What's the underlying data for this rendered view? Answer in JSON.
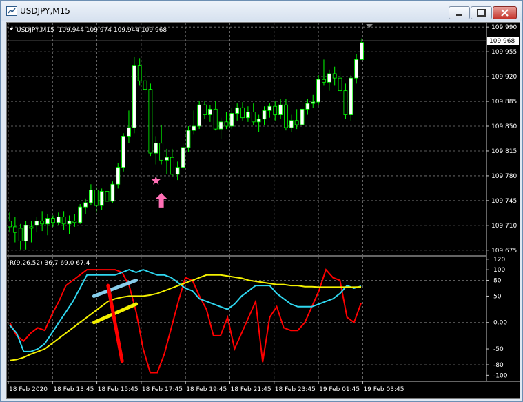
{
  "window": {
    "title": "USDJPY,M15"
  },
  "colors": {
    "background": "#000000",
    "grid": "#7c7c7c",
    "bull": "#ffffff",
    "bear": "#00ff00",
    "text": "#ffffff",
    "red_line": "#ff0000",
    "cyan_line": "#2fd7f0",
    "yellow_line": "#f3f000",
    "marker": "#ff6fb5"
  },
  "chart_data": [
    {
      "type": "candlestick",
      "header": {
        "symbol": "USDJPY,M15",
        "ohlc": "109.944 109.974 109.944 109.968"
      },
      "current_price": "109.968",
      "y_ticks": [
        "109.990",
        "109.955",
        "109.920",
        "109.885",
        "109.850",
        "109.815",
        "109.780",
        "109.745",
        "109.710",
        "109.675"
      ],
      "ylim": [
        109.668,
        109.996
      ],
      "candles": [
        {
          "o": 109.716,
          "h": 109.728,
          "l": 109.7,
          "c": 109.708
        },
        {
          "o": 109.708,
          "h": 109.722,
          "l": 109.686,
          "c": 109.7
        },
        {
          "o": 109.706,
          "h": 109.712,
          "l": 109.676,
          "c": 109.688
        },
        {
          "o": 109.688,
          "h": 109.716,
          "l": 109.676,
          "c": 109.71
        },
        {
          "o": 109.708,
          "h": 109.716,
          "l": 109.686,
          "c": 109.706
        },
        {
          "o": 109.71,
          "h": 109.722,
          "l": 109.7,
          "c": 109.716
        },
        {
          "o": 109.716,
          "h": 109.73,
          "l": 109.702,
          "c": 109.712
        },
        {
          "o": 109.712,
          "h": 109.726,
          "l": 109.696,
          "c": 109.72
        },
        {
          "o": 109.72,
          "h": 109.724,
          "l": 109.708,
          "c": 109.714
        },
        {
          "o": 109.714,
          "h": 109.728,
          "l": 109.71,
          "c": 109.722
        },
        {
          "o": 109.722,
          "h": 109.73,
          "l": 109.704,
          "c": 109.712
        },
        {
          "o": 109.712,
          "h": 109.724,
          "l": 109.698,
          "c": 109.716
        },
        {
          "o": 109.716,
          "h": 109.726,
          "l": 109.708,
          "c": 109.714
        },
        {
          "o": 109.714,
          "h": 109.74,
          "l": 109.712,
          "c": 109.736
        },
        {
          "o": 109.736,
          "h": 109.748,
          "l": 109.726,
          "c": 109.742
        },
        {
          "o": 109.742,
          "h": 109.768,
          "l": 109.738,
          "c": 109.76
        },
        {
          "o": 109.76,
          "h": 109.764,
          "l": 109.728,
          "c": 109.738
        },
        {
          "o": 109.738,
          "h": 109.762,
          "l": 109.732,
          "c": 109.758
        },
        {
          "o": 109.758,
          "h": 109.78,
          "l": 109.74,
          "c": 109.744
        },
        {
          "o": 109.744,
          "h": 109.772,
          "l": 109.742,
          "c": 109.768
        },
        {
          "o": 109.768,
          "h": 109.798,
          "l": 109.762,
          "c": 109.792
        },
        {
          "o": 109.792,
          "h": 109.84,
          "l": 109.786,
          "c": 109.836
        },
        {
          "o": 109.836,
          "h": 109.872,
          "l": 109.826,
          "c": 109.848
        },
        {
          "o": 109.848,
          "h": 109.948,
          "l": 109.84,
          "c": 109.936
        },
        {
          "o": 109.936,
          "h": 109.946,
          "l": 109.908,
          "c": 109.914
        },
        {
          "o": 109.914,
          "h": 109.928,
          "l": 109.896,
          "c": 109.902
        },
        {
          "o": 109.902,
          "h": 109.91,
          "l": 109.808,
          "c": 109.812
        },
        {
          "o": 109.812,
          "h": 109.836,
          "l": 109.796,
          "c": 109.826
        },
        {
          "o": 109.826,
          "h": 109.852,
          "l": 109.796,
          "c": 109.802
        },
        {
          "o": 109.802,
          "h": 109.818,
          "l": 109.782,
          "c": 109.806
        },
        {
          "o": 109.806,
          "h": 109.818,
          "l": 109.778,
          "c": 109.782
        },
        {
          "o": 109.782,
          "h": 109.8,
          "l": 109.774,
          "c": 109.792
        },
        {
          "o": 109.792,
          "h": 109.826,
          "l": 109.788,
          "c": 109.82
        },
        {
          "o": 109.82,
          "h": 109.85,
          "l": 109.814,
          "c": 109.844
        },
        {
          "o": 109.844,
          "h": 109.872,
          "l": 109.838,
          "c": 109.85
        },
        {
          "o": 109.85,
          "h": 109.886,
          "l": 109.846,
          "c": 109.88
        },
        {
          "o": 109.88,
          "h": 109.886,
          "l": 109.86,
          "c": 109.866
        },
        {
          "o": 109.866,
          "h": 109.88,
          "l": 109.856,
          "c": 109.874
        },
        {
          "o": 109.874,
          "h": 109.886,
          "l": 109.844,
          "c": 109.846
        },
        {
          "o": 109.846,
          "h": 109.862,
          "l": 109.832,
          "c": 109.856
        },
        {
          "o": 109.856,
          "h": 109.87,
          "l": 109.846,
          "c": 109.85
        },
        {
          "o": 109.85,
          "h": 109.876,
          "l": 109.846,
          "c": 109.868
        },
        {
          "o": 109.868,
          "h": 109.882,
          "l": 109.858,
          "c": 109.876
        },
        {
          "o": 109.876,
          "h": 109.884,
          "l": 109.858,
          "c": 109.862
        },
        {
          "o": 109.862,
          "h": 109.878,
          "l": 109.856,
          "c": 109.87
        },
        {
          "o": 109.87,
          "h": 109.882,
          "l": 109.852,
          "c": 109.856
        },
        {
          "o": 109.856,
          "h": 109.866,
          "l": 109.842,
          "c": 109.86
        },
        {
          "o": 109.86,
          "h": 109.878,
          "l": 109.852,
          "c": 109.872
        },
        {
          "o": 109.872,
          "h": 109.882,
          "l": 109.862,
          "c": 109.878
        },
        {
          "o": 109.878,
          "h": 109.886,
          "l": 109.858,
          "c": 109.866
        },
        {
          "o": 109.866,
          "h": 109.888,
          "l": 109.86,
          "c": 109.88
        },
        {
          "o": 109.88,
          "h": 109.888,
          "l": 109.844,
          "c": 109.848
        },
        {
          "o": 109.848,
          "h": 109.866,
          "l": 109.842,
          "c": 109.858
        },
        {
          "o": 109.858,
          "h": 109.874,
          "l": 109.846,
          "c": 109.852
        },
        {
          "o": 109.852,
          "h": 109.882,
          "l": 109.848,
          "c": 109.874
        },
        {
          "o": 109.874,
          "h": 109.888,
          "l": 109.866,
          "c": 109.882
        },
        {
          "o": 109.882,
          "h": 109.894,
          "l": 109.876,
          "c": 109.884
        },
        {
          "o": 109.884,
          "h": 109.922,
          "l": 109.88,
          "c": 109.916
        },
        {
          "o": 109.916,
          "h": 109.944,
          "l": 109.908,
          "c": 109.912
        },
        {
          "o": 109.912,
          "h": 109.93,
          "l": 109.9,
          "c": 109.924
        },
        {
          "o": 109.924,
          "h": 109.934,
          "l": 109.908,
          "c": 109.918
        },
        {
          "o": 109.918,
          "h": 109.928,
          "l": 109.896,
          "c": 109.9
        },
        {
          "o": 109.9,
          "h": 109.91,
          "l": 109.86,
          "c": 109.866
        },
        {
          "o": 109.866,
          "h": 109.922,
          "l": 109.858,
          "c": 109.918
        },
        {
          "o": 109.918,
          "h": 109.952,
          "l": 109.91,
          "c": 109.944
        },
        {
          "o": 109.944,
          "h": 109.974,
          "l": 109.944,
          "c": 109.968
        }
      ],
      "markers": [
        {
          "type": "star",
          "index": 27,
          "price": 109.773
        },
        {
          "type": "up-arrow",
          "index": 28,
          "price": 109.745
        }
      ]
    },
    {
      "type": "line",
      "header": "R(9,26,52) 36.7 69.0 67.4",
      "y_ticks": [
        "120",
        "100",
        "80",
        "50",
        "0.00",
        "-50",
        "-80",
        "-100"
      ],
      "ylim": [
        -110,
        125
      ],
      "series": [
        {
          "color": "#ff0000",
          "values": [
            0,
            -25,
            -35,
            -20,
            -10,
            -15,
            15,
            40,
            70,
            80,
            90,
            100,
            100,
            100,
            100,
            100,
            95,
            70,
            20,
            -50,
            -95,
            -95,
            -60,
            -10,
            40,
            85,
            80,
            50,
            25,
            -25,
            -25,
            10,
            -50,
            -20,
            10,
            40,
            -75,
            10,
            30,
            -10,
            -15,
            -15,
            0,
            30,
            60,
            100,
            85,
            80,
            10,
            0,
            36.7
          ]
        },
        {
          "color": "#2fd7f0",
          "values": [
            -5,
            -20,
            -55,
            -55,
            -50,
            -40,
            -20,
            0,
            20,
            40,
            65,
            90,
            90,
            90,
            90,
            90,
            95,
            100,
            95,
            100,
            95,
            90,
            90,
            85,
            75,
            65,
            60,
            45,
            40,
            35,
            30,
            25,
            35,
            50,
            60,
            70,
            70,
            70,
            55,
            45,
            35,
            30,
            30,
            30,
            35,
            40,
            45,
            55,
            70,
            65,
            69.0
          ]
        },
        {
          "color": "#f3f000",
          "values": [
            -72,
            -70,
            -66,
            -60,
            -55,
            -50,
            -40,
            -30,
            -20,
            -10,
            0,
            10,
            20,
            30,
            40,
            45,
            48,
            50,
            50,
            50,
            52,
            55,
            60,
            65,
            70,
            75,
            80,
            85,
            90,
            90,
            90,
            88,
            86,
            84,
            80,
            78,
            76,
            74,
            72,
            72,
            70,
            70,
            68,
            68,
            67,
            67,
            67,
            67,
            67,
            67,
            67.4
          ]
        }
      ],
      "trendlines": [
        {
          "color": "#87ceeb",
          "from": [
            12,
            50
          ],
          "to": [
            18,
            80
          ]
        },
        {
          "color": "#f3f000",
          "from": [
            12,
            0
          ],
          "to": [
            18,
            35
          ]
        },
        {
          "color": "#ff0000",
          "from": [
            14,
            70
          ],
          "to": [
            16,
            -73
          ]
        }
      ]
    }
  ],
  "x_axis": {
    "labels": [
      "18 Feb 2020",
      "18 Feb 13:45",
      "18 Feb 15:45",
      "18 Feb 17:45",
      "18 Feb 19:45",
      "18 Feb 21:45",
      "18 Feb 23:45",
      "19 Feb 01:45",
      "19 Feb 03:45"
    ]
  }
}
